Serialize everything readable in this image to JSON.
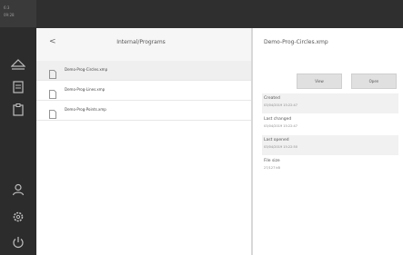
{
  "status": {
    "line1": "6:3",
    "line2": "09:28"
  },
  "browser": {
    "back_glyph": "<",
    "path": "Internal/Programs",
    "files": [
      {
        "name": "Demo-Prog-Circles.xmp"
      },
      {
        "name": "Demo-Prog-Lines.xmp"
      },
      {
        "name": "Demo-Prog-Points.xmp"
      }
    ]
  },
  "details": {
    "title": "Demo-Prog-Circles.xmp",
    "view_label": "View",
    "open_label": "Open",
    "created_label": "Created",
    "created_value": "03/04/2019 15:22:47",
    "changed_label": "Last changed",
    "changed_value": "03/04/2019 15:22:47",
    "opened_label": "Last opened",
    "opened_value": "03/04/2019 15:22:50",
    "size_label": "File size",
    "size_value": "27/127 kB"
  },
  "sidebar_icons": [
    "eject-icon",
    "document-icon",
    "clipboard-icon",
    "user-icon",
    "settings-icon",
    "power-icon"
  ],
  "colors": {
    "sidebar": "#2c2c2c",
    "topbar": "#2f2f2f",
    "icon": "#bdbdbd"
  }
}
